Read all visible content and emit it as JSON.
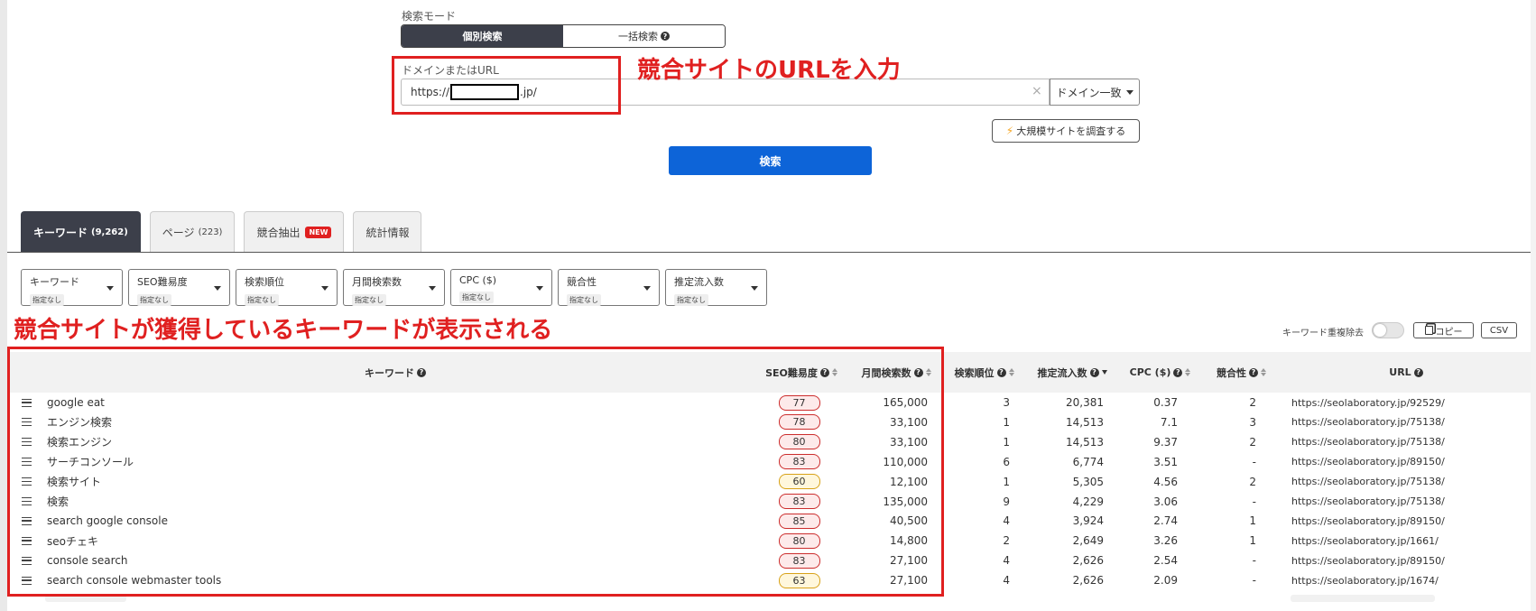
{
  "search": {
    "mode_label": "検索モード",
    "mode_individual": "個別検索",
    "mode_bulk": "一括検索",
    "domain_label": "ドメインまたはURL",
    "url_prefix": "https://",
    "url_suffix": ".jp/",
    "clear": "×",
    "match_type": "ドメイン一致",
    "large_site_button": "大規模サイトを調査する",
    "search_button": "検索"
  },
  "annotations": {
    "url_note": "競合サイトのURLを入力",
    "keyword_note": "競合サイトが獲得しているキーワードが表示される"
  },
  "tabs": [
    {
      "label": "キーワード",
      "count": "(9,262)"
    },
    {
      "label": "ページ",
      "count": "(223)"
    },
    {
      "label": "競合抽出",
      "badge": "NEW"
    },
    {
      "label": "統計情報"
    }
  ],
  "filters": [
    {
      "label": "キーワード",
      "sub": "指定なし"
    },
    {
      "label": "SEO難易度",
      "sub": "指定なし"
    },
    {
      "label": "検索順位",
      "sub": "指定なし"
    },
    {
      "label": "月間検索数",
      "sub": "指定なし"
    },
    {
      "label": "CPC ($)",
      "sub": "指定なし"
    },
    {
      "label": "競合性",
      "sub": "指定なし"
    },
    {
      "label": "推定流入数",
      "sub": "指定なし"
    }
  ],
  "controls": {
    "dedupe_label": "キーワード重複除去",
    "copy": "コピー",
    "csv": "CSV"
  },
  "table": {
    "headers": {
      "keyword": "キーワード",
      "seo": "SEO難易度",
      "volume": "月間検索数",
      "rank": "検索順位",
      "traffic": "推定流入数",
      "cpc": "CPC ($)",
      "competition": "競合性",
      "url": "URL"
    },
    "rows": [
      {
        "keyword": "google eat",
        "seo": "77",
        "volume": "165,000",
        "rank": "3",
        "traffic": "20,381",
        "cpc": "0.37",
        "competition": "2",
        "url": "https://seolaboratory.jp/92529/"
      },
      {
        "keyword": "エンジン検索",
        "seo": "78",
        "volume": "33,100",
        "rank": "1",
        "traffic": "14,513",
        "cpc": "7.1",
        "competition": "3",
        "url": "https://seolaboratory.jp/75138/"
      },
      {
        "keyword": "検索エンジン",
        "seo": "80",
        "volume": "33,100",
        "rank": "1",
        "traffic": "14,513",
        "cpc": "9.37",
        "competition": "2",
        "url": "https://seolaboratory.jp/75138/"
      },
      {
        "keyword": "サーチコンソール",
        "seo": "83",
        "volume": "110,000",
        "rank": "6",
        "traffic": "6,774",
        "cpc": "3.51",
        "competition": "-",
        "url": "https://seolaboratory.jp/89150/"
      },
      {
        "keyword": "検索サイト",
        "seo": "60",
        "volume": "12,100",
        "rank": "1",
        "traffic": "5,305",
        "cpc": "4.56",
        "competition": "2",
        "url": "https://seolaboratory.jp/75138/"
      },
      {
        "keyword": "検索",
        "seo": "83",
        "volume": "135,000",
        "rank": "9",
        "traffic": "4,229",
        "cpc": "3.06",
        "competition": "-",
        "url": "https://seolaboratory.jp/75138/"
      },
      {
        "keyword": "search google console",
        "seo": "85",
        "volume": "40,500",
        "rank": "4",
        "traffic": "3,924",
        "cpc": "2.74",
        "competition": "1",
        "url": "https://seolaboratory.jp/89150/"
      },
      {
        "keyword": "seoチェキ",
        "seo": "80",
        "volume": "14,800",
        "rank": "2",
        "traffic": "2,649",
        "cpc": "3.26",
        "competition": "1",
        "url": "https://seolaboratory.jp/1661/"
      },
      {
        "keyword": "console search",
        "seo": "83",
        "volume": "27,100",
        "rank": "4",
        "traffic": "2,626",
        "cpc": "2.54",
        "competition": "-",
        "url": "https://seolaboratory.jp/89150/"
      },
      {
        "keyword": "search console webmaster tools",
        "seo": "63",
        "volume": "27,100",
        "rank": "4",
        "traffic": "2,626",
        "cpc": "2.09",
        "competition": "-",
        "url": "https://seolaboratory.jp/1674/"
      }
    ]
  },
  "colors": {
    "accent_blue": "#0d64d8",
    "dark_tab": "#3c3f4a",
    "annotation_red": "#e02020"
  }
}
